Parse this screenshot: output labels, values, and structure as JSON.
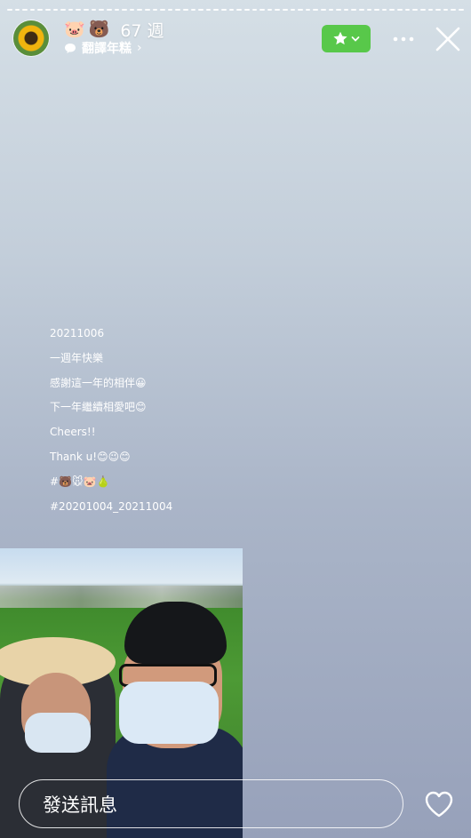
{
  "story": {
    "progress_segments": 60,
    "progress_done": 60
  },
  "header": {
    "user_emojis": [
      "🐷",
      "🐻"
    ],
    "age": "67 週",
    "subtitle": "翻譯年糕",
    "subtitle_chevron": "›"
  },
  "caption": {
    "lines": [
      "20211006",
      "一週年快樂",
      "感謝這一年的相伴😀",
      "下一年繼續相愛吧😊",
      "Cheers!!",
      "Thank u!😊😉😊",
      "#🐻🐭🐷🍐",
      "#20201004_20211004"
    ]
  },
  "footer": {
    "message_placeholder": "發送訊息"
  },
  "colors": {
    "star_button": "#58c84a",
    "text": "#ffffff"
  },
  "icons": {
    "star": "star-icon",
    "more": "more-icon",
    "close": "close-icon",
    "heart": "heart-icon",
    "chat": "chat-bubble-icon"
  }
}
